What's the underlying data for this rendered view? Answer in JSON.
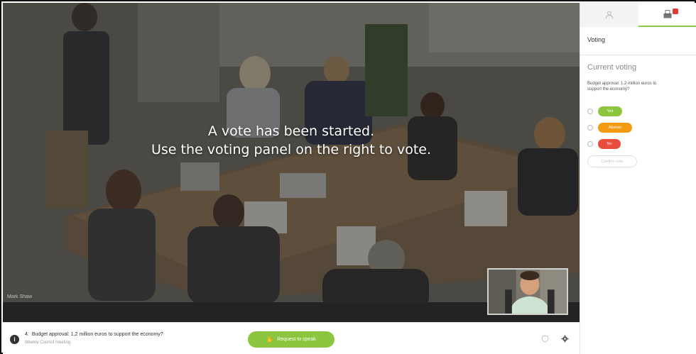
{
  "stage": {
    "message_line1": "A vote has been started.",
    "message_line2": "Use the voting panel on the right to vote.",
    "speaker_name": "Mark Shaw"
  },
  "bottombar": {
    "agenda_number": "4.",
    "agenda_title": "Budget approval: 1,2 million euros to support the economy?",
    "meeting_name": "Weekly Council meeting",
    "request_button": "Request to speak",
    "info_icon": "i"
  },
  "panel": {
    "title": "Voting",
    "section_heading": "Current voting",
    "question": "Budget approval: 1,2 million euros to support the economy?",
    "options": [
      {
        "label": "Yes",
        "color": "#8cc63f"
      },
      {
        "label": "Abstain",
        "color": "#f39c12"
      },
      {
        "label": "No",
        "color": "#e74c3c"
      }
    ],
    "confirm_button": "Confirm vote",
    "accent_color": "#8cc63f"
  },
  "icons": {
    "tab_people": "people-icon",
    "tab_votes": "ballot-box-icon",
    "request": "hand-icon",
    "bottom_left": "info-icon",
    "bottom_shield": "shield-icon",
    "bottom_gear": "gear-icon"
  }
}
